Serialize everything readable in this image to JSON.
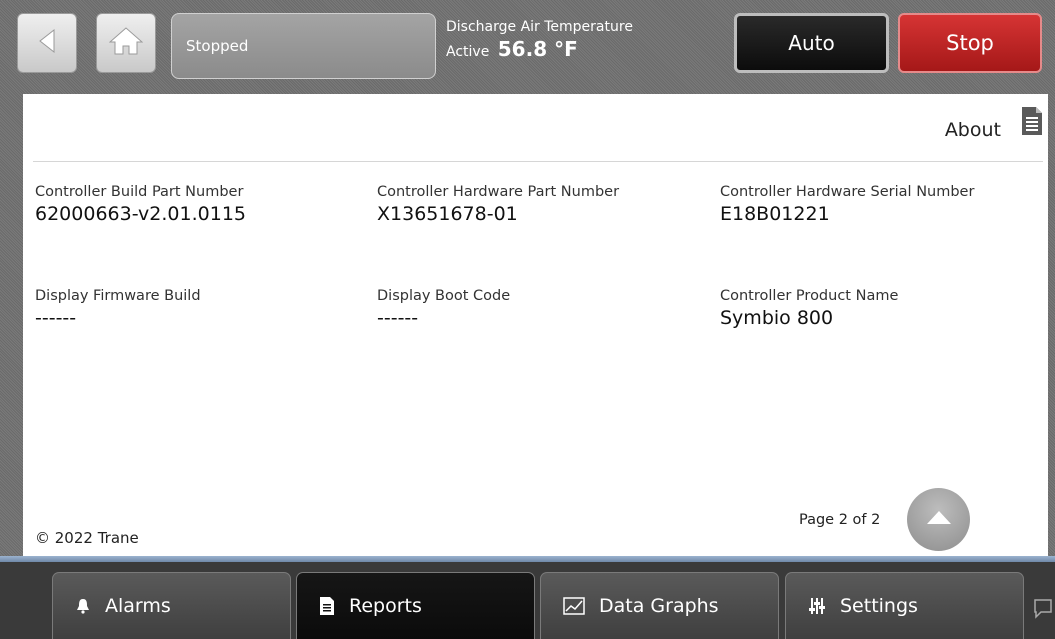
{
  "header": {
    "status": "Stopped",
    "dat_title": "Discharge Air Temperature",
    "dat_active_label": "Active",
    "dat_value": "56.8 °F",
    "auto_label": "Auto",
    "stop_label": "Stop",
    "icons": {
      "back": "back-arrow-icon",
      "home": "home-icon"
    }
  },
  "about": {
    "label": "About",
    "icon": "document-icon"
  },
  "fields": [
    {
      "label": "Controller Build Part Number",
      "value": "62000663-v2.01.0115"
    },
    {
      "label": "Controller Hardware Part Number",
      "value": "X13651678-01"
    },
    {
      "label": "Controller Hardware Serial Number",
      "value": "E18B01221"
    },
    {
      "label": "Display Firmware Build",
      "value": "------"
    },
    {
      "label": "Display Boot Code",
      "value": "------"
    },
    {
      "label": "Controller Product Name",
      "value": "Symbio 800"
    }
  ],
  "footer": {
    "copyright": "© 2022 Trane",
    "page": "Page 2 of 2"
  },
  "nav": {
    "tabs": [
      {
        "label": "Alarms",
        "icon": "bell-icon"
      },
      {
        "label": "Reports",
        "icon": "document-icon"
      },
      {
        "label": "Data Graphs",
        "icon": "graph-icon"
      },
      {
        "label": "Settings",
        "icon": "sliders-icon"
      }
    ],
    "active": "Reports"
  },
  "colors": {
    "stop": "#c42424",
    "auto": "#111111",
    "panel": "#ffffff"
  }
}
